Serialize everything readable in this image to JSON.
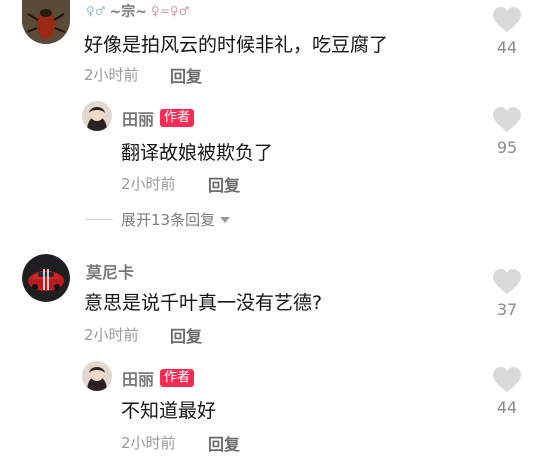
{
  "comments": [
    {
      "author": "~宗~",
      "text": "好像是拍风云的时候非礼，吃豆腐了",
      "time": "2小时前",
      "reply_label": "回复",
      "likes": "44",
      "replies": [
        {
          "author": "田丽",
          "badge": "作者",
          "text": "翻译故娘被欺负了",
          "time": "2小时前",
          "reply_label": "回复",
          "likes": "95"
        }
      ],
      "expand_label": "展开13条回复"
    },
    {
      "author": "莫尼卡",
      "text": "意思是说千叶真一没有艺德?",
      "time": "2小时前",
      "reply_label": "回复",
      "likes": "37",
      "replies": [
        {
          "author": "田丽",
          "badge": "作者",
          "text": "不知道最好",
          "time": "2小时前",
          "reply_label": "回复",
          "likes": "44"
        }
      ]
    }
  ]
}
